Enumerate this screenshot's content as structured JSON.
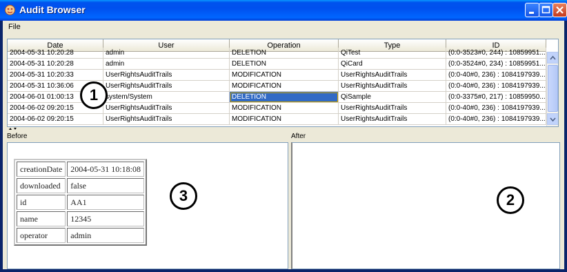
{
  "window": {
    "title": "Audit Browser",
    "menu": {
      "file": "File"
    }
  },
  "table": {
    "columns": [
      "Date",
      "User",
      "Operation",
      "Type",
      "ID"
    ],
    "rows": [
      [
        "2004-05-31 10:20:28",
        "admin",
        "DELETION",
        "QiTest",
        "(0:0-3523#0, 244) : 10859951..."
      ],
      [
        "2004-05-31 10:20:28",
        "admin",
        "DELETION",
        "QiCard",
        "(0:0-3524#0, 234) : 10859951..."
      ],
      [
        "2004-05-31 10:20:33",
        "UserRightsAuditTrails",
        "MODIFICATION",
        "UserRightsAuditTrails",
        "(0:0-40#0, 236) : 1084197939..."
      ],
      [
        "2004-05-31 10:36:06",
        "UserRightsAuditTrails",
        "MODIFICATION",
        "UserRightsAuditTrails",
        "(0:0-40#0, 236) : 1084197939..."
      ],
      [
        "2004-06-01 01:00:13",
        "system/System",
        "DELETION",
        "QiSample",
        "(0:0-3375#0, 217) : 10859950..."
      ],
      [
        "2004-06-02 09:20:15",
        "UserRightsAuditTrails",
        "MODIFICATION",
        "UserRightsAuditTrails",
        "(0:0-40#0, 236) : 1084197939..."
      ],
      [
        "2004-06-02 09:20:15",
        "UserRightsAuditTrails",
        "MODIFICATION",
        "UserRightsAuditTrails",
        "(0:0-40#0, 236) : 1084197939..."
      ]
    ]
  },
  "before": {
    "label": "Before",
    "properties": [
      [
        "creationDate",
        "2004-05-31 10:18:08"
      ],
      [
        "downloaded",
        "false"
      ],
      [
        "id",
        "AA1"
      ],
      [
        "name",
        "12345"
      ],
      [
        "operator",
        "admin"
      ]
    ]
  },
  "after": {
    "label": "After"
  },
  "callouts": {
    "one": "1",
    "two": "2",
    "three": "3"
  },
  "colors": {
    "title_bar": "#0055ea",
    "selection": "#316ac5",
    "face": "#ece9d8"
  }
}
